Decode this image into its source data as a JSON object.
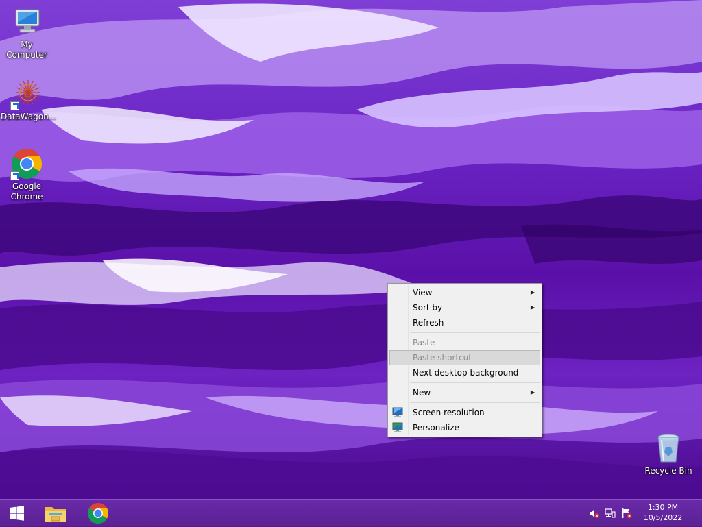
{
  "desktop": {
    "icons": [
      {
        "label": "My Computer"
      },
      {
        "label": "DataWagon..."
      },
      {
        "label": "Google Chrome"
      },
      {
        "label": "Recycle Bin"
      }
    ]
  },
  "context_menu": {
    "items": [
      {
        "label": "View",
        "has_submenu": true,
        "enabled": true
      },
      {
        "label": "Sort by",
        "has_submenu": true,
        "enabled": true
      },
      {
        "label": "Refresh",
        "enabled": true
      },
      {
        "label": "Paste",
        "enabled": false
      },
      {
        "label": "Paste shortcut",
        "enabled": false,
        "highlighted": true
      },
      {
        "label": "Next desktop background",
        "enabled": true
      },
      {
        "label": "New",
        "has_submenu": true,
        "enabled": true
      },
      {
        "label": "Screen resolution",
        "enabled": true,
        "icon": "monitor-icon"
      },
      {
        "label": "Personalize",
        "enabled": true,
        "icon": "personalize-icon"
      }
    ],
    "submenu_arrow": "▶"
  },
  "taskbar": {
    "start_icon": "windows-logo-icon",
    "pinned": [
      "file-explorer-icon",
      "chrome-icon"
    ],
    "tray_icons": [
      "volume-muted-icon",
      "network-icon",
      "action-center-flag-icon"
    ],
    "clock": {
      "time": "1:30 PM",
      "date": "10/5/2022"
    }
  },
  "colors": {
    "taskbar": "#5c2194",
    "menu_bg": "#f0f0f0",
    "menu_highlight": "#d9d9d9",
    "disabled_text": "#8c8c8c"
  }
}
